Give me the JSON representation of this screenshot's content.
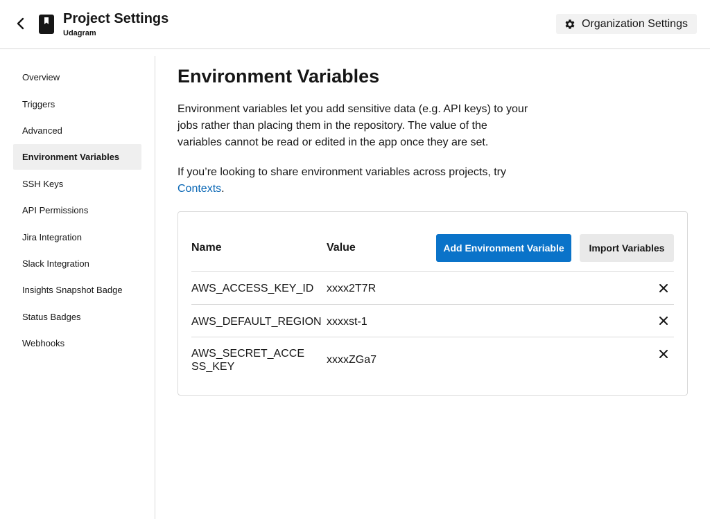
{
  "header": {
    "title": "Project Settings",
    "subtitle": "Udagram",
    "org_settings_label": "Organization Settings"
  },
  "sidebar": {
    "items": [
      {
        "label": "Overview",
        "active": false
      },
      {
        "label": "Triggers",
        "active": false
      },
      {
        "label": "Advanced",
        "active": false
      },
      {
        "label": "Environment Variables",
        "active": true
      },
      {
        "label": "SSH Keys",
        "active": false
      },
      {
        "label": "API Permissions",
        "active": false
      },
      {
        "label": "Jira Integration",
        "active": false
      },
      {
        "label": "Slack Integration",
        "active": false
      },
      {
        "label": "Insights Snapshot Badge",
        "active": false
      },
      {
        "label": "Status Badges",
        "active": false
      },
      {
        "label": "Webhooks",
        "active": false
      }
    ]
  },
  "main": {
    "title": "Environment Variables",
    "description": "Environment variables let you add sensitive data (e.g. API keys) to your jobs rather than placing them in the repository. The value of the variables cannot be read or edited in the app once they are set.",
    "share_text": "If you’re looking to share environment variables across projects, try ",
    "contexts_link": "Contexts",
    "share_end": "."
  },
  "table": {
    "col_name": "Name",
    "col_value": "Value",
    "add_button": "Add Environment Variable",
    "import_button": "Import Variables",
    "rows": [
      {
        "name": "AWS_ACCESS_KEY_ID",
        "value": "xxxx2T7R"
      },
      {
        "name": "AWS_DEFAULT_REGION",
        "value": "xxxxst-1"
      },
      {
        "name": "AWS_SECRET_ACCESS_KEY",
        "value": "xxxxZGa7"
      }
    ]
  },
  "colors": {
    "accent": "#0a73c9",
    "link": "#0a67b5",
    "active_nav_bg": "#efefef",
    "border": "#d9d9d9"
  },
  "icons": {
    "back": "chevron-left-icon",
    "project": "bookmark-icon",
    "org_settings": "gear-icon",
    "delete": "close-icon"
  }
}
